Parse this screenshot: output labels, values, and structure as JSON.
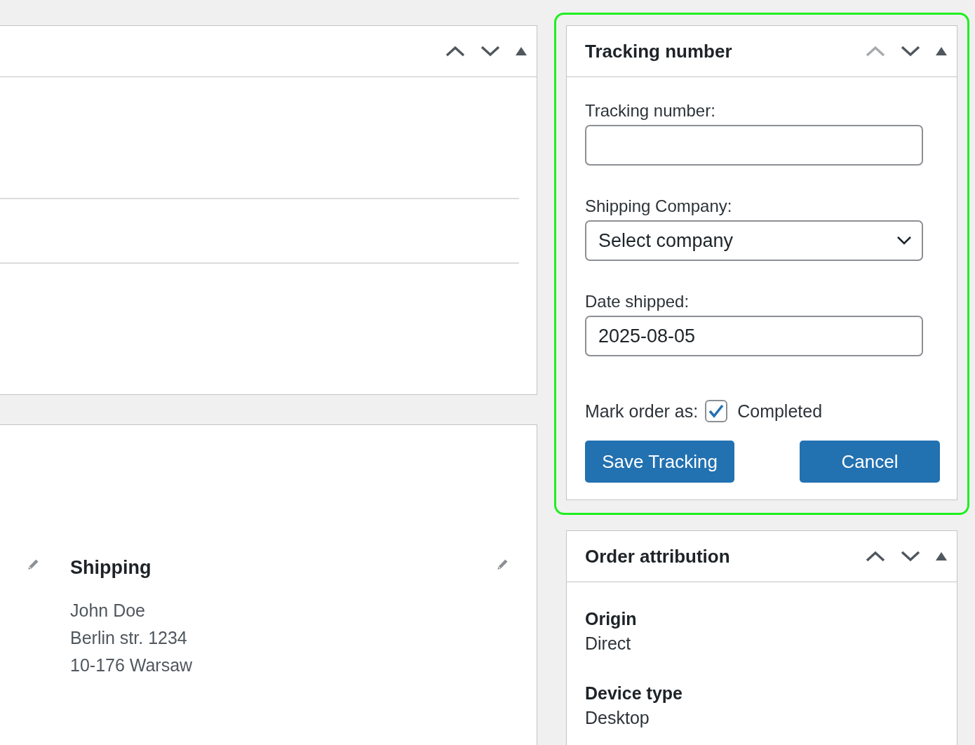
{
  "order_panel": {
    "up_disabled": false
  },
  "shipping": {
    "title": "Shipping",
    "address_lines": [
      "John Doe",
      "Berlin str. 1234",
      "10-176 Warsaw"
    ]
  },
  "tracking_panel": {
    "title": "Tracking number",
    "up_disabled": true,
    "fields": [
      {
        "kind": "text",
        "label": "Tracking number:"
      },
      {
        "kind": "select",
        "label": "Shipping Company:",
        "value": "Select company"
      },
      {
        "kind": "text",
        "label": "Date shipped:",
        "value": "2025-08-05"
      }
    ],
    "mark_order": {
      "label": "Mark order as:",
      "checked": true,
      "option": "Completed"
    },
    "buttons": [
      "Save Tracking",
      "Cancel"
    ]
  },
  "attribution_panel": {
    "title": "Order attribution",
    "up_disabled": false,
    "items": [
      {
        "label": "Origin",
        "value": "Direct"
      },
      {
        "label": "Device type",
        "value": "Desktop"
      }
    ]
  }
}
